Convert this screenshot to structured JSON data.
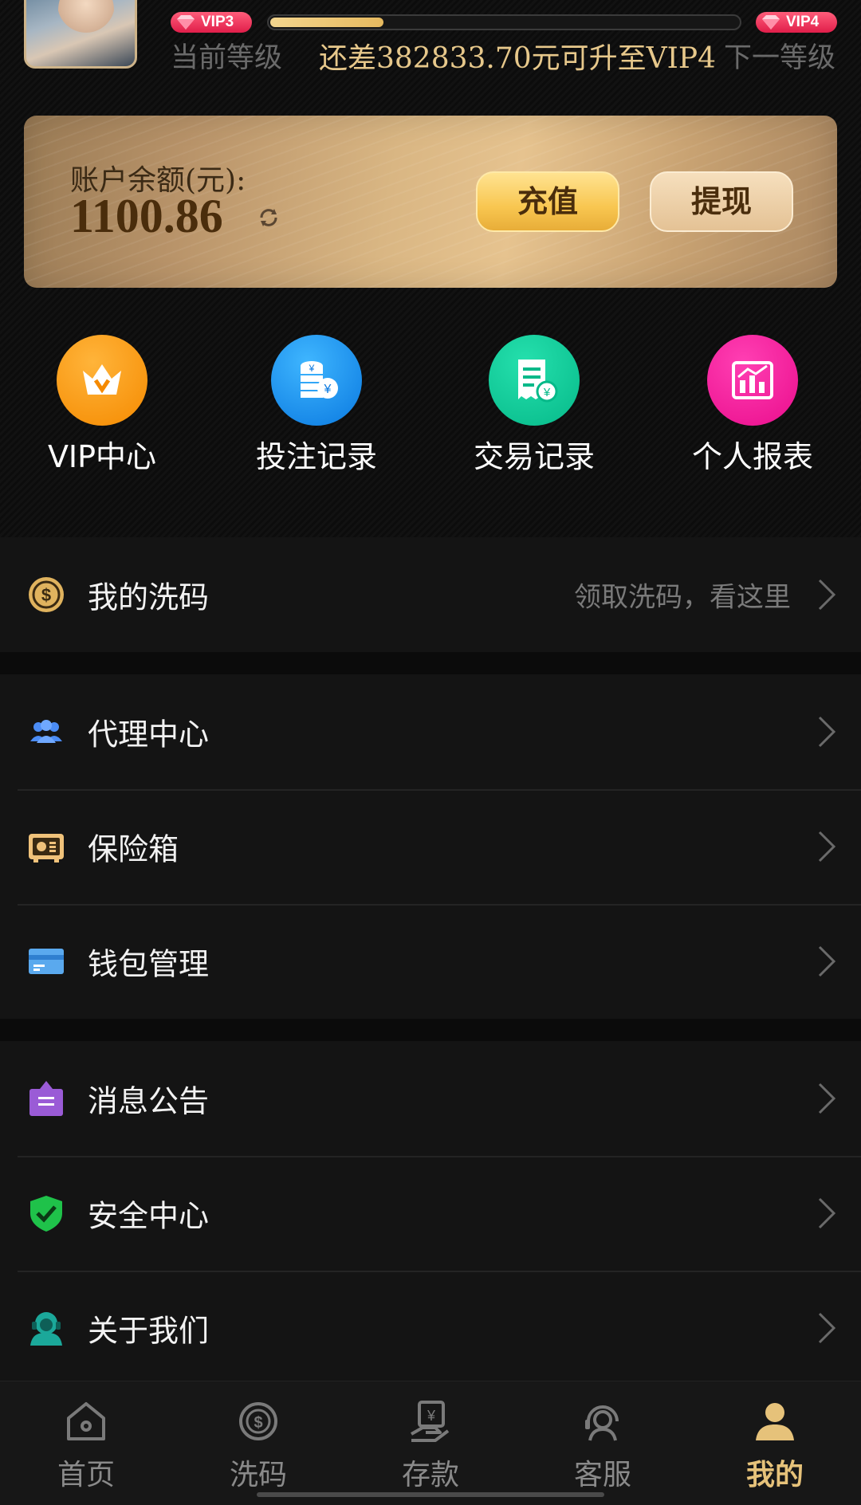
{
  "header": {
    "current_badge": "VIP3",
    "next_badge": "VIP4",
    "progress": 0.24,
    "current_level_label": "当前等级",
    "next_level_label": "下一等级",
    "upgrade_hint": "还差382833.70元可升至VIP4"
  },
  "balance": {
    "label": "账户余额(元):",
    "amount": "1100.86",
    "recharge_label": "充值",
    "withdraw_label": "提现"
  },
  "quick_actions": [
    {
      "label": "VIP中心",
      "icon": "crown-icon",
      "color": "#f58a00"
    },
    {
      "label": "投注记录",
      "icon": "coin-stack-icon",
      "color": "#0a79e0"
    },
    {
      "label": "交易记录",
      "icon": "receipt-icon",
      "color": "#06b989"
    },
    {
      "label": "个人报表",
      "icon": "chart-icon",
      "color": "#ea0d8c"
    }
  ],
  "menu": {
    "wash": {
      "label": "我的洗码",
      "hint": "领取洗码，看这里",
      "icon": "dollar-coin-icon"
    },
    "agent": {
      "label": "代理中心",
      "icon": "users-icon"
    },
    "safe": {
      "label": "保险箱",
      "icon": "safe-icon"
    },
    "wallet": {
      "label": "钱包管理",
      "icon": "card-icon"
    },
    "notice": {
      "label": "消息公告",
      "icon": "announcement-icon"
    },
    "security": {
      "label": "安全中心",
      "icon": "shield-check-icon"
    },
    "about": {
      "label": "关于我们",
      "icon": "support-agent-icon"
    }
  },
  "tabs": [
    {
      "label": "首页",
      "icon": "home-icon"
    },
    {
      "label": "洗码",
      "icon": "dollar-target-icon"
    },
    {
      "label": "存款",
      "icon": "deposit-icon"
    },
    {
      "label": "客服",
      "icon": "headset-icon"
    },
    {
      "label": "我的",
      "icon": "user-icon",
      "active": true
    }
  ]
}
